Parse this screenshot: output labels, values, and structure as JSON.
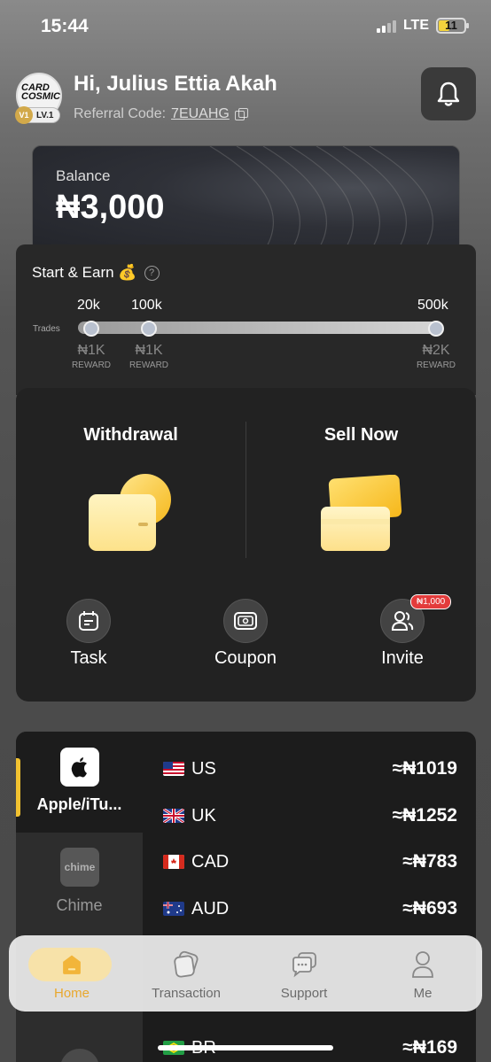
{
  "status": {
    "time": "15:44",
    "network": "LTE",
    "battery": "11"
  },
  "header": {
    "greeting": "Hi, Julius Ettia Akah",
    "referral_label": "Referral Code:",
    "referral_code": "7EUAHG",
    "avatar_text": "CARD COSMIC",
    "level_badge": "V1",
    "level": "LV.1"
  },
  "balance": {
    "label": "Balance",
    "amount": "₦3,000"
  },
  "earn": {
    "title": "Start & Earn 💰",
    "help": "?",
    "trades_label": "Trades",
    "tiers": [
      {
        "target": "20k",
        "reward": "₦1K",
        "caption": "REWARD"
      },
      {
        "target": "100k",
        "reward": "₦1K",
        "caption": "REWARD"
      },
      {
        "target": "500k",
        "reward": "₦2K",
        "caption": "REWARD"
      }
    ]
  },
  "actions": {
    "withdrawal": "Withdrawal",
    "sell_now": "Sell Now",
    "task": "Task",
    "coupon": "Coupon",
    "invite": "Invite",
    "invite_badge": "₦1,000"
  },
  "brands": [
    {
      "name": "Apple/iTu...",
      "logo": "apple-logo"
    },
    {
      "name": "Chime",
      "logo_text": "chime"
    }
  ],
  "rates": [
    {
      "country": "US",
      "rate": "≈₦1019"
    },
    {
      "country": "UK",
      "rate": "≈₦1252"
    },
    {
      "country": "CAD",
      "rate": "≈₦783"
    },
    {
      "country": "AUD",
      "rate": "≈₦693"
    },
    {
      "country": "BR",
      "rate": "≈₦169"
    }
  ],
  "nav": {
    "home": "Home",
    "transaction": "Transaction",
    "support": "Support",
    "me": "Me"
  },
  "colors": {
    "accent": "#f2c230",
    "nav_active": "#e9a82e",
    "badge": "#e33b3b"
  }
}
